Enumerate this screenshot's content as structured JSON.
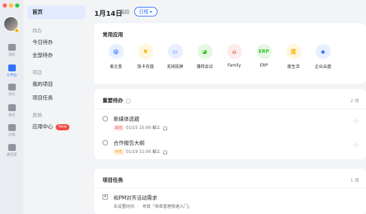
{
  "rail": {
    "items": [
      {
        "label": "消息",
        "icon": "chat-icon"
      },
      {
        "label": "工作台",
        "icon": "workbench-icon"
      },
      {
        "label": "日历",
        "icon": "calendar-icon"
      },
      {
        "label": "会议",
        "icon": "video-icon"
      },
      {
        "label": "文档",
        "icon": "doc-icon"
      },
      {
        "label": "通讯录",
        "icon": "contacts-icon"
      }
    ]
  },
  "nav": {
    "home": "首页",
    "group_todo": "待办",
    "today_todo": "今日待办",
    "all_todo": "全部待办",
    "group_project": "项目",
    "my_projects": "我的项目",
    "project_tasks": "项目任务",
    "group_other": "其他",
    "app_center": "应用中心",
    "new_badge": "New"
  },
  "header": {
    "date": "1月14日",
    "weekday": "周四",
    "schedule_btn": "日程 ▸"
  },
  "common_apps": {
    "title": "常用应用",
    "apps": [
      {
        "label": "爱企查",
        "glyph": "@",
        "color": "#3370ff",
        "bg": "#e8f0ff",
        "icon": "aiqicha-icon"
      },
      {
        "label": "饭卡充值",
        "glyph": "¥",
        "color": "#f5b400",
        "bg": "#fff6dd",
        "icon": "mealcard-icon"
      },
      {
        "label": "无线投屏",
        "glyph": "▭",
        "color": "#3370ff",
        "bg": "#e8f0ff",
        "icon": "cast-icon"
      },
      {
        "label": "蒲荷会议",
        "glyph": "◕",
        "color": "#34c724",
        "bg": "#e6f7e3",
        "icon": "meeting-icon"
      },
      {
        "label": "Family",
        "glyph": "⌂",
        "color": "#f54a45",
        "bg": "#fdeceb",
        "icon": "family-icon"
      },
      {
        "label": "ERP",
        "glyph": "ERP",
        "color": "#34c724",
        "bg": "#e6f7e3",
        "icon": "erp-icon"
      },
      {
        "label": "度生活",
        "glyph": "度",
        "color": "#f5b400",
        "bg": "#fff6dd",
        "icon": "dushenghuo-icon"
      },
      {
        "label": "企业云盘",
        "glyph": "◆",
        "color": "#3370ff",
        "bg": "#e8f0ff",
        "icon": "cloud-disk-icon"
      }
    ]
  },
  "important_todo": {
    "title": "重要待办",
    "count": "2 项",
    "tasks": [
      {
        "title": "新媒体选题",
        "priority": "高优",
        "prio_color": "#f54a45",
        "prio_bg": "#fdeceb",
        "due": "01/15 15:00 截止"
      },
      {
        "title": "合作报告大纲",
        "priority": "中优",
        "prio_color": "#ff8800",
        "prio_bg": "#fff1e0",
        "due": "01/19 11:00 截止"
      }
    ]
  },
  "project_tasks": {
    "title": "项目任务",
    "count": "1 项",
    "tasks": [
      {
        "title": "和PM对齐活动需求",
        "time": "未设置时间",
        "project": "项目「项目管理快速入门」"
      }
    ]
  }
}
